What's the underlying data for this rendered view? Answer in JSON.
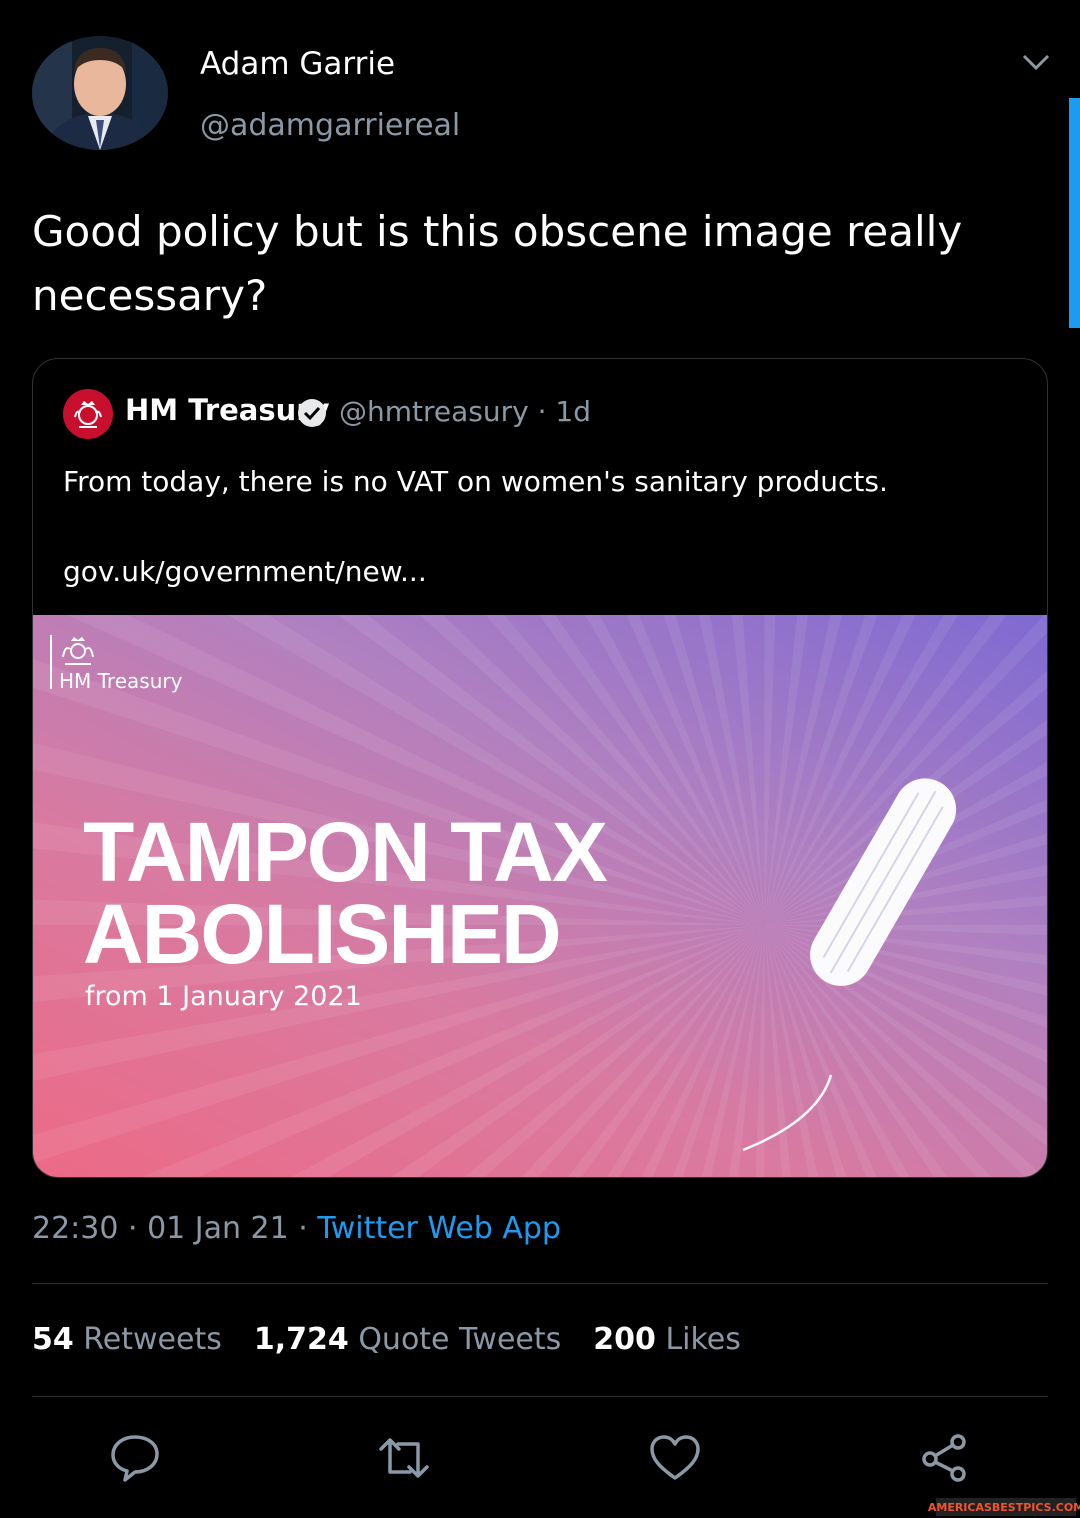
{
  "tweet": {
    "author_name": "Adam Garrie",
    "author_handle": "@adamgarriereal",
    "text": "Good policy but is this obscene image really necessary?"
  },
  "quoted_tweet": {
    "name": "HM Treasury",
    "handle_time": "@hmtreasury · 1d",
    "text": "From today, there is no VAT on women's sanitary products.",
    "link": "gov.uk/government/new...",
    "media": {
      "logo_text": "HM Treasury",
      "headline_line1": "TAMPON TAX",
      "headline_line2": "ABOLISHED",
      "subline": "from 1 January 2021"
    }
  },
  "meta": {
    "timestamp": "22:30 · 01 Jan 21 · ",
    "source": "Twitter Web App"
  },
  "stats": {
    "retweets_count": "54",
    "retweets_label": "Retweets",
    "quotes_count": "1,724",
    "quotes_label": "Quote Tweets",
    "likes_count": "200",
    "likes_label": "Likes"
  },
  "actions": [
    "reply-icon",
    "retweet-icon",
    "like-icon",
    "share-icon"
  ],
  "watermark": "AMERICASBESTPICS.COM",
  "colors": {
    "background": "#000000",
    "link": "#1d9bf0",
    "secondary_text": "#8b98a5"
  }
}
